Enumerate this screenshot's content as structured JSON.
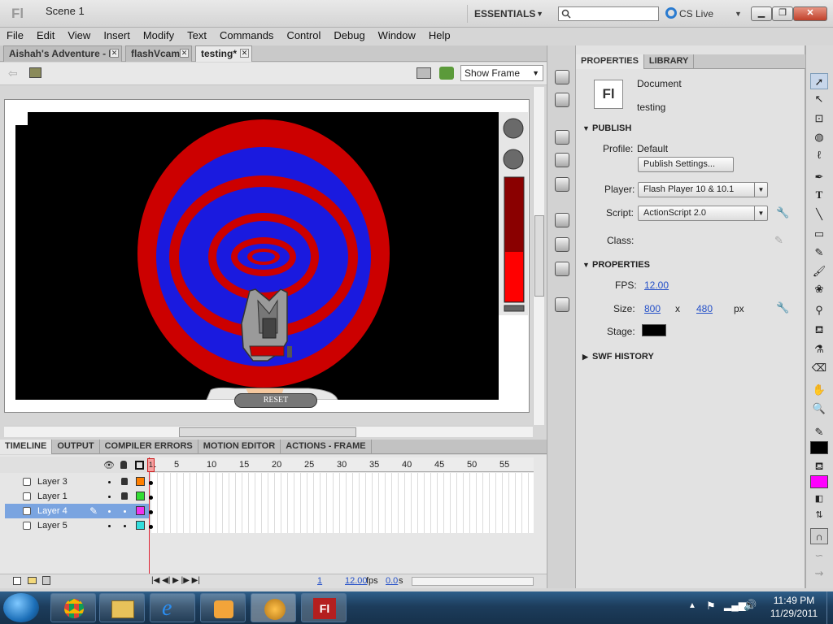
{
  "app": {
    "logo": "Fl"
  },
  "titlebar": {
    "workspace": "ESSENTIALS",
    "search_placeholder": "",
    "cs_live": "CS Live",
    "min": "▁",
    "max": "❐",
    "close": "✕"
  },
  "menu": [
    "File",
    "Edit",
    "View",
    "Insert",
    "Modify",
    "Text",
    "Commands",
    "Control",
    "Debug",
    "Window",
    "Help"
  ],
  "doc_tabs": [
    {
      "label": "Aishah's Adventure - I",
      "active": false
    },
    {
      "label": "flashVcam",
      "active": false
    },
    {
      "label": "testing*",
      "active": true
    }
  ],
  "scene": {
    "label": "Scene 1",
    "show_frame": "Show Frame"
  },
  "stage": {
    "reset_button": "RESET"
  },
  "timeline": {
    "tabs": [
      "TIMELINE",
      "OUTPUT",
      "COMPILER ERRORS",
      "MOTION EDITOR",
      "ACTIONS - FRAME"
    ],
    "frame_numbers": [
      "1",
      "5",
      "10",
      "15",
      "20",
      "25",
      "30",
      "35",
      "40",
      "45",
      "50",
      "55"
    ],
    "layers": [
      {
        "name": "Layer 3",
        "color": "#ff7f00",
        "locked": true,
        "selected": false
      },
      {
        "name": "Layer 1",
        "color": "#33dd33",
        "locked": true,
        "selected": false
      },
      {
        "name": "Layer 4",
        "color": "#ee33ee",
        "locked": false,
        "selected": true
      },
      {
        "name": "Layer 5",
        "color": "#33dddd",
        "locked": false,
        "selected": false
      }
    ],
    "status": {
      "frame": "1",
      "fps": "12.00",
      "fps_unit": "fps",
      "time": "0.0",
      "time_unit": "s"
    }
  },
  "properties": {
    "tabs": [
      "PROPERTIES",
      "LIBRARY"
    ],
    "doc_icon": "Fl",
    "doc_type": "Document",
    "doc_name": "testing",
    "publish": {
      "heading": "PUBLISH",
      "profile_label": "Profile:",
      "profile_value": "Default",
      "publish_settings": "Publish Settings...",
      "player_label": "Player:",
      "player_value": "Flash Player 10 & 10.1",
      "script_label": "Script:",
      "script_value": "ActionScript 2.0",
      "class_label": "Class:"
    },
    "props": {
      "heading": "PROPERTIES",
      "fps_label": "FPS:",
      "fps_value": "12.00",
      "size_label": "Size:",
      "width": "800",
      "x": "x",
      "height": "480",
      "unit": "px",
      "stage_label": "Stage:",
      "stage_color": "#000000"
    },
    "swf_history": "SWF HISTORY"
  },
  "tray": {
    "time": "11:49 PM",
    "date": "11/29/2011"
  },
  "colors": {
    "fill": "#ff00ff",
    "stroke": "#000000",
    "target_red": "#cc0000",
    "target_blue": "#1a1adf"
  }
}
